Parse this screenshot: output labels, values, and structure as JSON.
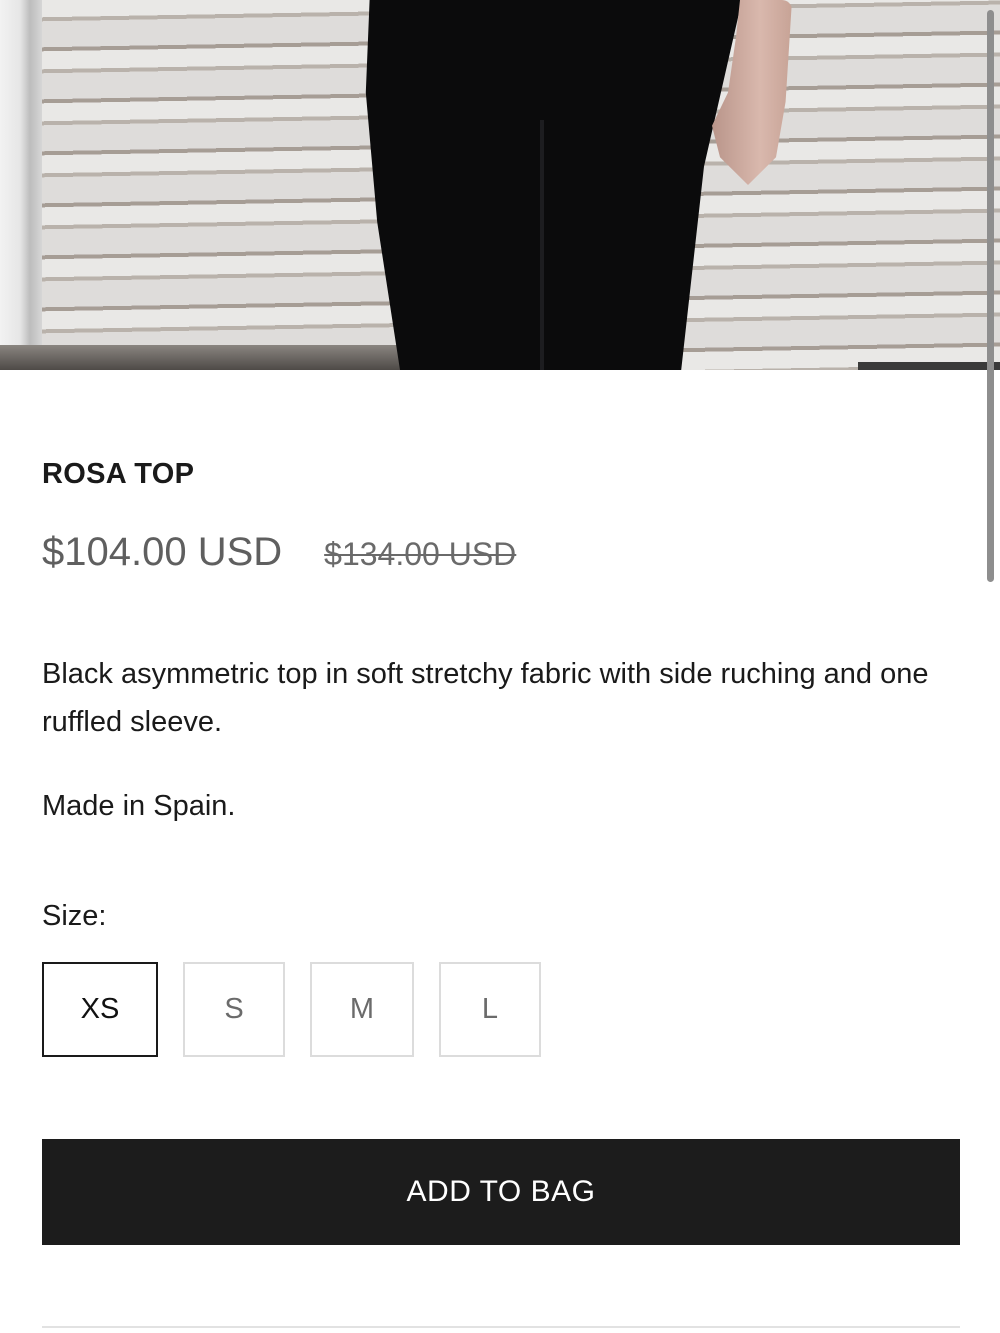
{
  "product": {
    "title": "ROSA TOP",
    "price": "$104.00 USD",
    "compare_at_price": "$134.00 USD",
    "description": "Black asymmetric top in soft stretchy fabric with side ruching and one ruffled sleeve.",
    "origin": "Made in Spain."
  },
  "size": {
    "label": "Size:",
    "options": [
      "XS",
      "S",
      "M",
      "L"
    ],
    "selected": "XS"
  },
  "actions": {
    "add_to_bag": "ADD TO BAG"
  }
}
